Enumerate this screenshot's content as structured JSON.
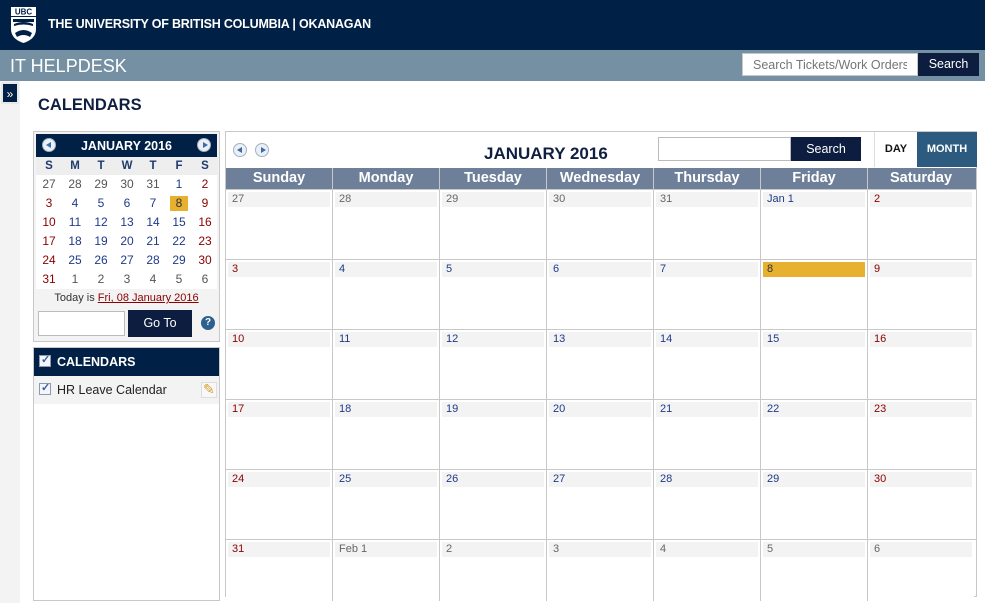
{
  "header": {
    "university": "THE UNIVERSITY OF BRITISH COLUMBIA | OKANAGAN",
    "logo_text": "UBC",
    "app_title": "IT HELPDESK",
    "search_placeholder": "Search Tickets/Work Orders",
    "search_label": "Search"
  },
  "sidebar_toggle": "»",
  "page_title": "CALENDARS",
  "mini_calendar": {
    "title": "JANUARY 2016",
    "dow": [
      "S",
      "M",
      "T",
      "W",
      "T",
      "F",
      "S"
    ],
    "weeks": [
      [
        {
          "d": "27",
          "t": "other"
        },
        {
          "d": "28",
          "t": "other"
        },
        {
          "d": "29",
          "t": "other"
        },
        {
          "d": "30",
          "t": "other"
        },
        {
          "d": "31",
          "t": "other"
        },
        {
          "d": "1",
          "t": ""
        },
        {
          "d": "2",
          "t": "weekend"
        }
      ],
      [
        {
          "d": "3",
          "t": "weekend"
        },
        {
          "d": "4",
          "t": ""
        },
        {
          "d": "5",
          "t": ""
        },
        {
          "d": "6",
          "t": ""
        },
        {
          "d": "7",
          "t": ""
        },
        {
          "d": "8",
          "t": "today"
        },
        {
          "d": "9",
          "t": "weekend"
        }
      ],
      [
        {
          "d": "10",
          "t": "weekend"
        },
        {
          "d": "11",
          "t": ""
        },
        {
          "d": "12",
          "t": ""
        },
        {
          "d": "13",
          "t": ""
        },
        {
          "d": "14",
          "t": ""
        },
        {
          "d": "15",
          "t": ""
        },
        {
          "d": "16",
          "t": "weekend"
        }
      ],
      [
        {
          "d": "17",
          "t": "weekend"
        },
        {
          "d": "18",
          "t": ""
        },
        {
          "d": "19",
          "t": ""
        },
        {
          "d": "20",
          "t": ""
        },
        {
          "d": "21",
          "t": ""
        },
        {
          "d": "22",
          "t": ""
        },
        {
          "d": "23",
          "t": "weekend"
        }
      ],
      [
        {
          "d": "24",
          "t": "weekend"
        },
        {
          "d": "25",
          "t": ""
        },
        {
          "d": "26",
          "t": ""
        },
        {
          "d": "27",
          "t": ""
        },
        {
          "d": "28",
          "t": ""
        },
        {
          "d": "29",
          "t": ""
        },
        {
          "d": "30",
          "t": "weekend"
        }
      ],
      [
        {
          "d": "31",
          "t": "weekend"
        },
        {
          "d": "1",
          "t": "other"
        },
        {
          "d": "2",
          "t": "other"
        },
        {
          "d": "3",
          "t": "other"
        },
        {
          "d": "4",
          "t": "other"
        },
        {
          "d": "5",
          "t": "other"
        },
        {
          "d": "6",
          "t": "other"
        }
      ]
    ],
    "today_prefix": "Today is ",
    "today_link": "Fri, 08 January 2016",
    "goto_value": "",
    "goto_label": "Go To",
    "help_icon": "?"
  },
  "calendars_panel": {
    "title": "CALENDARS",
    "items": [
      {
        "label": "HR Leave Calendar",
        "checked": true
      }
    ]
  },
  "main_calendar": {
    "title": "JANUARY 2016",
    "search_value": "",
    "search_label": "Search",
    "views": {
      "day": "DAY",
      "month": "MONTH"
    },
    "active_view": "MONTH",
    "dow": [
      "Sunday",
      "Monday",
      "Tuesday",
      "Wednesday",
      "Thursday",
      "Friday",
      "Saturday"
    ],
    "weeks": [
      [
        {
          "d": "27",
          "t": "other"
        },
        {
          "d": "28",
          "t": "other"
        },
        {
          "d": "29",
          "t": "other"
        },
        {
          "d": "30",
          "t": "other"
        },
        {
          "d": "31",
          "t": "other"
        },
        {
          "d": "Jan 1",
          "t": ""
        },
        {
          "d": "2",
          "t": "weekend"
        }
      ],
      [
        {
          "d": "3",
          "t": "weekend"
        },
        {
          "d": "4",
          "t": ""
        },
        {
          "d": "5",
          "t": ""
        },
        {
          "d": "6",
          "t": ""
        },
        {
          "d": "7",
          "t": ""
        },
        {
          "d": "8",
          "t": "today"
        },
        {
          "d": "9",
          "t": "weekend"
        }
      ],
      [
        {
          "d": "10",
          "t": "weekend"
        },
        {
          "d": "11",
          "t": ""
        },
        {
          "d": "12",
          "t": ""
        },
        {
          "d": "13",
          "t": ""
        },
        {
          "d": "14",
          "t": ""
        },
        {
          "d": "15",
          "t": ""
        },
        {
          "d": "16",
          "t": "weekend"
        }
      ],
      [
        {
          "d": "17",
          "t": "weekend"
        },
        {
          "d": "18",
          "t": ""
        },
        {
          "d": "19",
          "t": ""
        },
        {
          "d": "20",
          "t": ""
        },
        {
          "d": "21",
          "t": ""
        },
        {
          "d": "22",
          "t": ""
        },
        {
          "d": "23",
          "t": "weekend"
        }
      ],
      [
        {
          "d": "24",
          "t": "weekend"
        },
        {
          "d": "25",
          "t": ""
        },
        {
          "d": "26",
          "t": ""
        },
        {
          "d": "27",
          "t": ""
        },
        {
          "d": "28",
          "t": ""
        },
        {
          "d": "29",
          "t": ""
        },
        {
          "d": "30",
          "t": "weekend"
        }
      ],
      [
        {
          "d": "31",
          "t": "weekend"
        },
        {
          "d": "Feb 1",
          "t": "other"
        },
        {
          "d": "2",
          "t": "other"
        },
        {
          "d": "3",
          "t": "other"
        },
        {
          "d": "4",
          "t": "other"
        },
        {
          "d": "5",
          "t": "other"
        },
        {
          "d": "6",
          "t": "other"
        }
      ]
    ]
  },
  "colors": {
    "brand_navy": "#002145",
    "subbar": "#7590a2",
    "today_highlight": "#e8b02f",
    "weekend_text": "#8b0000",
    "weekday_text": "#1e3a8a",
    "dow_header": "#6e7f99",
    "month_view_active": "#2c5b7f"
  }
}
